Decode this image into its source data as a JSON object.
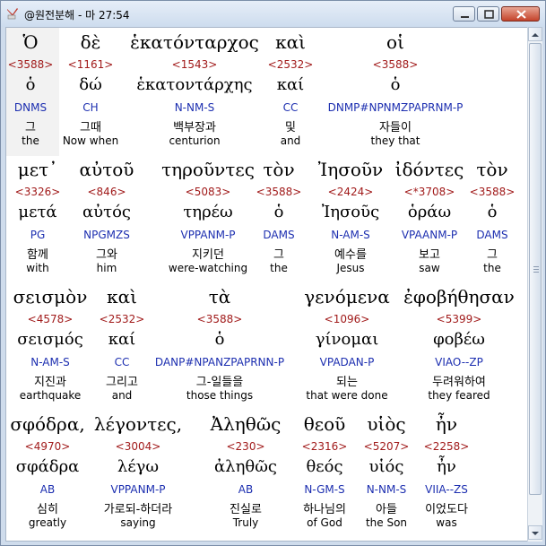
{
  "window": {
    "title": "@원전분해 - 마 27:54",
    "buttons": [
      "minimize-icon",
      "maximize-icon",
      "close-icon"
    ]
  },
  "colors": {
    "strong": "#a11b1b",
    "parse": "#1d2fb0",
    "highlight": "#f2f2f2"
  },
  "rows": [
    {
      "words": [
        {
          "greek": "Ὁ",
          "strong": "<3588>",
          "lemma": "ὁ",
          "parse": "DNMS",
          "korean": "그",
          "english": "the"
        },
        {
          "greek": "δὲ",
          "strong": "<1161>",
          "lemma": "δώ",
          "parse": "CH",
          "korean": "그때",
          "english": "Now when"
        },
        {
          "greek": "ἑκατόνταρχος",
          "strong": "<1543>",
          "lemma": "ἑκατοντάρχης",
          "parse": "N-NM-S",
          "korean": "백부장과",
          "english": "centurion"
        },
        {
          "greek": "καὶ",
          "strong": "<2532>",
          "lemma": "καί",
          "parse": "CC",
          "korean": "및",
          "english": "and"
        },
        {
          "greek": "οἱ",
          "strong": "<3588>",
          "lemma": "ὁ",
          "parse": "DNMP#NPNMZPAPRNM-P",
          "korean": "자들이",
          "english": "they that"
        }
      ]
    },
    {
      "words": [
        {
          "greek": "μετ᾽",
          "strong": "<3326>",
          "lemma": "μετά",
          "parse": "PG",
          "korean": "함께",
          "english": "with"
        },
        {
          "greek": "αὐτοῦ",
          "strong": "<846>",
          "lemma": "αὐτός",
          "parse": "NPGMZS",
          "korean": "그와",
          "english": "him"
        },
        {
          "greek": "τηροῦντες",
          "strong": "<5083>",
          "lemma": "τηρέω",
          "parse": "VPPANM-P",
          "korean": "지키던",
          "english": "were-watching"
        },
        {
          "greek": "τὸν",
          "strong": "<3588>",
          "lemma": "ὁ",
          "parse": "DAMS",
          "korean": "그",
          "english": "the"
        },
        {
          "greek": "Ἰησοῦν",
          "strong": "<2424>",
          "lemma": "Ἰησοῦς",
          "parse": "N-AM-S",
          "korean": "예수를",
          "english": "Jesus"
        },
        {
          "greek": "ἰδόντες",
          "strong": "<*3708>",
          "lemma": "ὁράω",
          "parse": "VPAANM-P",
          "korean": "보고",
          "english": "saw"
        },
        {
          "greek": "τὸν",
          "strong": "<3588>",
          "lemma": "ὁ",
          "parse": "DAMS",
          "korean": "그",
          "english": "the"
        }
      ]
    },
    {
      "words": [
        {
          "greek": "σεισμὸν",
          "strong": "<4578>",
          "lemma": "σεισμός",
          "parse": "N-AM-S",
          "korean": "지진과",
          "english": "earthquake"
        },
        {
          "greek": "καὶ",
          "strong": "<2532>",
          "lemma": "καί",
          "parse": "CC",
          "korean": "그리고",
          "english": "and"
        },
        {
          "greek": "τὰ",
          "strong": "<3588>",
          "lemma": "ὁ",
          "parse": "DANP#NPANZPAPRNN-P",
          "korean": "그-일들을",
          "english": "those things"
        },
        {
          "greek": "γενόμενα",
          "strong": "<1096>",
          "lemma": "γίνομαι",
          "parse": "VPADAN-P",
          "korean": "되는",
          "english": "that were done"
        },
        {
          "greek": "ἐφοβήθησαν",
          "strong": "<5399>",
          "lemma": "φοβέω",
          "parse": "VIAO--ZP",
          "korean": "두려워하여",
          "english": "they feared"
        }
      ]
    },
    {
      "words": [
        {
          "greek": "σφόδρα,",
          "strong": "<4970>",
          "lemma": "σφάδρα",
          "parse": "AB",
          "korean": "심히",
          "english": "greatly"
        },
        {
          "greek": "λέγοντες,",
          "strong": "<3004>",
          "lemma": "λέγω",
          "parse": "VPPANM-P",
          "korean": "가로되-하더라",
          "english": "saying"
        },
        {
          "greek": "Ἀληθῶς",
          "strong": "<230>",
          "lemma": "ἀληθῶς",
          "parse": "AB",
          "korean": "진실로",
          "english": "Truly"
        },
        {
          "greek": "θεοῦ",
          "strong": "<2316>",
          "lemma": "θεός",
          "parse": "N-GM-S",
          "korean": "하나님의",
          "english": "of God"
        },
        {
          "greek": "υἱὸς",
          "strong": "<5207>",
          "lemma": "υἱός",
          "parse": "N-NM-S",
          "korean": "아들",
          "english": "the Son"
        },
        {
          "greek": "ἦν",
          "strong": "<2258>",
          "lemma": "ἦν",
          "parse": "VIIA--ZS",
          "korean": "이었도다",
          "english": "was"
        }
      ]
    }
  ]
}
